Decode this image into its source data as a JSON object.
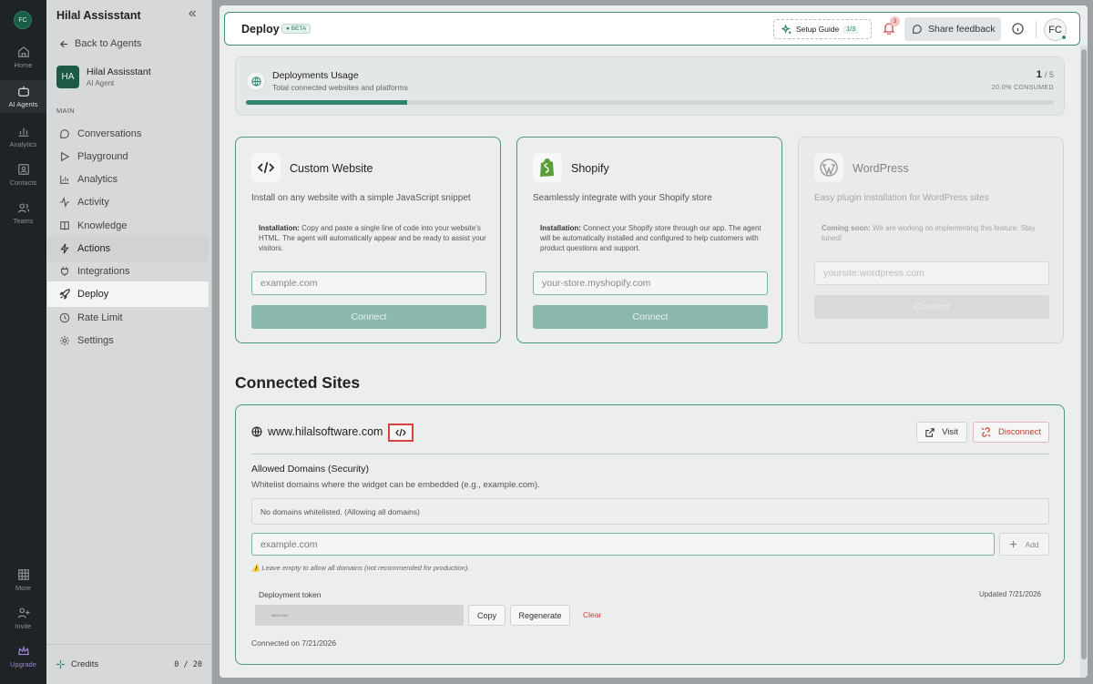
{
  "rail": {
    "avatar": "FC",
    "items": [
      {
        "label": "Home",
        "icon": "home-icon"
      },
      {
        "label": "AI Agents",
        "icon": "bot-icon"
      },
      {
        "label": "Analytics",
        "icon": "analytics-icon"
      },
      {
        "label": "Contacts",
        "icon": "contacts-icon"
      },
      {
        "label": "Teams",
        "icon": "teams-icon"
      },
      {
        "label": "More",
        "icon": "grid-icon"
      },
      {
        "label": "Invite",
        "icon": "invite-icon"
      },
      {
        "label": "Upgrade",
        "icon": "crown-icon"
      }
    ]
  },
  "sidebar": {
    "title": "Hilal Assisstant",
    "back_label": "Back to Agents",
    "agent": {
      "initials": "HA",
      "name": "Hilal Assisstant",
      "role": "AI Agent"
    },
    "section_label": "MAIN",
    "items": [
      {
        "label": "Conversations",
        "icon": "chat-icon"
      },
      {
        "label": "Playground",
        "icon": "play-icon"
      },
      {
        "label": "Analytics",
        "icon": "bar-chart-icon"
      },
      {
        "label": "Activity",
        "icon": "activity-icon"
      },
      {
        "label": "Knowledge",
        "icon": "book-icon"
      },
      {
        "label": "Actions",
        "icon": "bolt-icon"
      },
      {
        "label": "Integrations",
        "icon": "plug-icon"
      },
      {
        "label": "Deploy",
        "icon": "rocket-icon"
      },
      {
        "label": "Rate Limit",
        "icon": "clock-icon"
      },
      {
        "label": "Settings",
        "icon": "gear-icon"
      }
    ],
    "credits_label": "Credits",
    "credits_value": "0 / 20"
  },
  "header": {
    "title": "Deploy",
    "badge": "BETA",
    "setup_label": "Setup Guide",
    "setup_count": "1/3",
    "notification_count": "3",
    "feedback_label": "Share feedback",
    "user_initials": "FC"
  },
  "usage": {
    "title": "Deployments Usage",
    "subtitle": "Total connected websites and platforms",
    "used": "1",
    "total": "/ 5",
    "consumed_label": "20.0% CONSUMED",
    "progress_fraction": 0.2
  },
  "cards": [
    {
      "title": "Custom Website",
      "description": "Install on any website with a simple JavaScript snippet",
      "instruction_label": "Installation:",
      "instruction": " Copy and paste a single line of code into your website's HTML. The agent will automatically appear and be ready to assist your visitors.",
      "placeholder": "example.com",
      "button": "Connect"
    },
    {
      "title": "Shopify",
      "description": "Seamlessly integrate with your Shopify store",
      "instruction_label": "Installation:",
      "instruction": " Connect your Shopify store through our app. The agent will be automatically installed and configured to help customers with product questions and support.",
      "placeholder": "your-store.myshopify.com",
      "button": "Connect"
    },
    {
      "title": "WordPress",
      "description": "Easy plugin installation for WordPress sites",
      "instruction_label": "Coming soon:",
      "instruction": " We are working on implementing this feature. Stay tuned!",
      "placeholder": "yoursite.wordpress.com",
      "button": "Connect"
    }
  ],
  "connected": {
    "section_title": "Connected Sites",
    "site_url": "www.hilalsoftware.com",
    "visit_label": "Visit",
    "disconnect_label": "Disconnect",
    "domains_title": "Allowed Domains (Security)",
    "domains_subtitle": "Whitelist domains where the widget can be embedded (e.g., example.com).",
    "domains_empty": "No domains whitelisted. (Allowing all domains)",
    "domain_placeholder": "example.com",
    "add_label": "Add",
    "warning": "⚠️ Leave empty to allow all domains (not recommended for production).",
    "token_label": "Deployment token",
    "token_updated": "Updated 7/21/2026",
    "token_value": "9604c783",
    "copy_label": "Copy",
    "regenerate_label": "Regenerate",
    "clear_label": "Clear",
    "connected_on": "Connected on 7/21/2026"
  },
  "colors": {
    "accent": "#2f8470",
    "danger": "#d94040",
    "rail_bg": "#1e2326"
  }
}
